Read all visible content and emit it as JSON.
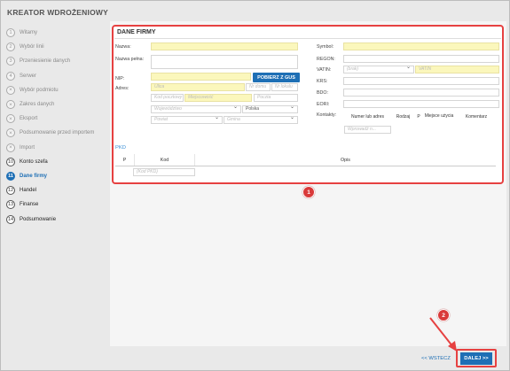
{
  "app": {
    "title": "KREATOR WDROŻENIOWY"
  },
  "sidebar": {
    "steps": [
      {
        "num": "1",
        "label": "Witamy",
        "state": "pending"
      },
      {
        "num": "2",
        "label": "Wybór linii",
        "state": "pending"
      },
      {
        "num": "3",
        "label": "Przeniesienie danych",
        "state": "pending"
      },
      {
        "num": "4",
        "label": "Serwer",
        "state": "pending"
      },
      {
        "num": "×",
        "label": "Wybór podmiotu",
        "state": "skipped"
      },
      {
        "num": "×",
        "label": "Zakres danych",
        "state": "skipped"
      },
      {
        "num": "×",
        "label": "Eksport",
        "state": "skipped"
      },
      {
        "num": "×",
        "label": "Podsumowanie przed importem",
        "state": "skipped"
      },
      {
        "num": "×",
        "label": "Import",
        "state": "skipped"
      },
      {
        "num": "10",
        "label": "Konto szefa",
        "state": "done"
      },
      {
        "num": "11",
        "label": "Dane firmy",
        "state": "active"
      },
      {
        "num": "12",
        "label": "Handel",
        "state": "done"
      },
      {
        "num": "13",
        "label": "Finanse",
        "state": "done"
      },
      {
        "num": "14",
        "label": "Podsumowanie",
        "state": "done"
      }
    ]
  },
  "form": {
    "title": "DANE FIRMY",
    "labels": {
      "nazwa": "Nazwa:",
      "nazwa_pelna": "Nazwa pełna:",
      "nip": "NIP:",
      "adres": "Adres:",
      "symbol": "Symbol:",
      "regon": "REGON:",
      "vatin": "VATIN:",
      "krs": "KRS:",
      "bdo": "BDO:",
      "eori": "EORI:",
      "kontakty": "Kontakty:"
    },
    "gus_button": "POBIERZ Z GUS",
    "placeholders": {
      "ulica": "Ulica",
      "nr_domu": "Nr domu",
      "nr_lokalu": "Nr lokalu",
      "kod_pocztowy": "Kod pocztowy",
      "miejscowosc": "Miejscowość",
      "poczta": "Poczta",
      "wojewodztwo": "Województwo",
      "kraj": "Polska",
      "powiat": "Powiat",
      "gmina": "Gmina",
      "vatin_prefix": "(brak)",
      "vatin": "VATIN",
      "contact_filter": "Wprowadź n...",
      "pkd_filter": "(Kod PKD)"
    },
    "contacts_columns": [
      "Numer lub adres",
      "Rodzaj",
      "P",
      "Miejsce użycia",
      "Komentarz"
    ],
    "pkd": {
      "link": "PKD",
      "columns": [
        "P",
        "Kod",
        "Opis"
      ]
    }
  },
  "footer": {
    "back": "<< WSTECZ",
    "next": "DALEJ >>"
  },
  "annotations": {
    "first": "1",
    "second": "2"
  },
  "colors": {
    "accent": "#1e6fb5",
    "highlight": "#e64141",
    "required": "#fbf7bc"
  }
}
